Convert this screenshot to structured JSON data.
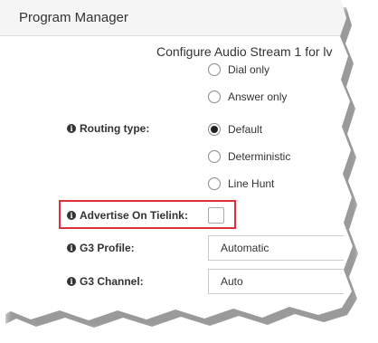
{
  "window": {
    "title": "Program Manager",
    "subtitle": "Configure Audio Stream 1 for lv"
  },
  "dial_mode": {
    "options": [
      "Dial only",
      "Answer only"
    ]
  },
  "routing_type": {
    "label": "Routing type:",
    "options": [
      "Default",
      "Deterministic",
      "Line Hunt"
    ],
    "selected": "Default"
  },
  "advertise_on_tielink": {
    "label": "Advertise On Tielink:",
    "checked": false,
    "highlight_color": "#e0313a"
  },
  "g3_profile": {
    "label": "G3 Profile:",
    "value": "Automatic"
  },
  "g3_channel": {
    "label": "G3 Channel:",
    "value": "Auto"
  },
  "icons": {
    "info": "i"
  }
}
